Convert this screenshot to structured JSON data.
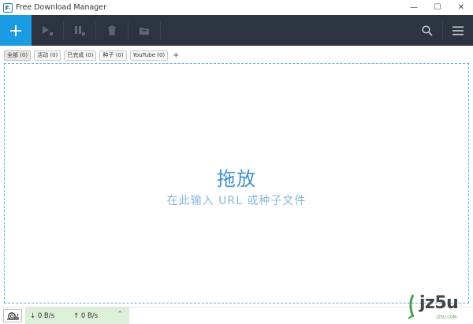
{
  "window": {
    "title": "Free Download Manager",
    "minimize_glyph": "—",
    "maximize_glyph": "☐",
    "close_glyph": "✕"
  },
  "toolbar": {
    "add_glyph": "+",
    "accent": "#1a9be2",
    "background": "#2c3440",
    "icons": [
      "add-icon",
      "start-icon",
      "pause-icon",
      "delete-icon",
      "folder-icon",
      "search-icon",
      "menu-icon"
    ]
  },
  "tabs": [
    {
      "label": "全部 (0)"
    },
    {
      "label": "活动 (0)"
    },
    {
      "label": "已完成 (0)"
    },
    {
      "label": "种子 (0)"
    },
    {
      "label": "YouTube (0)"
    }
  ],
  "tab_add_glyph": "+",
  "dropzone": {
    "title": "拖放",
    "subtitle": "在此输入 URL 或种子文件",
    "border_color": "#5cb0e0"
  },
  "statusbar": {
    "download_speed": "↓ 0 B/s",
    "upload_speed": "↑ 0 B/s",
    "chevron": "⌃"
  },
  "watermark": {
    "text": "jz5u",
    "small": "JZ5U.COM"
  }
}
